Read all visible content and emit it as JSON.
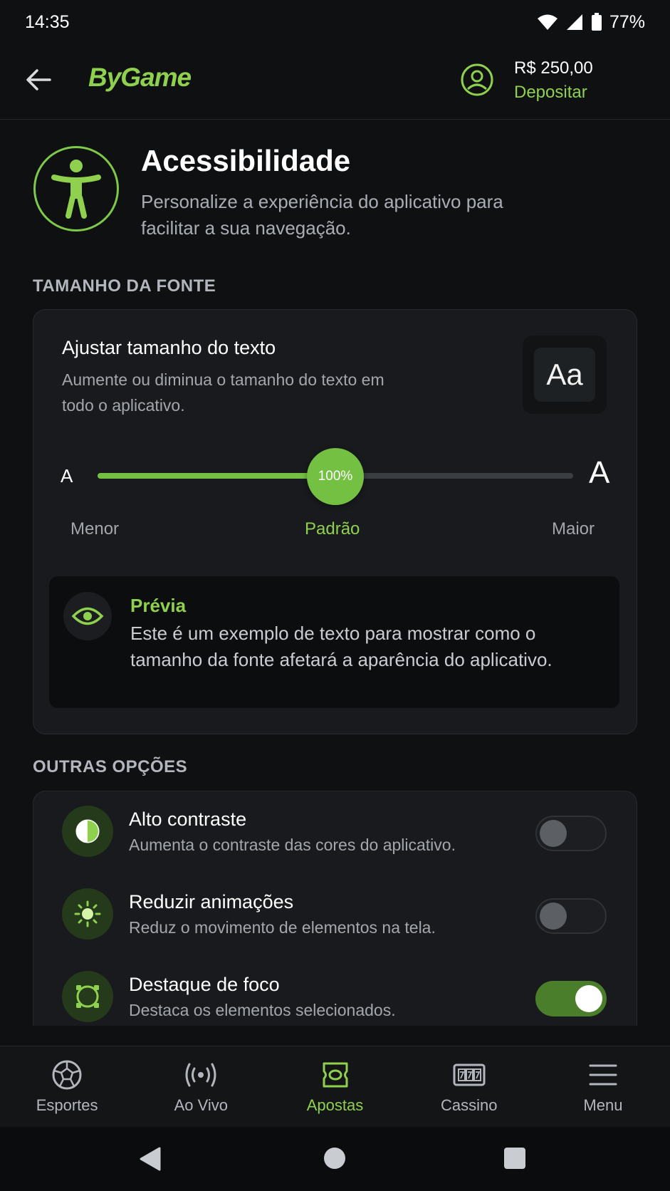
{
  "status_bar": {
    "time": "14:35",
    "battery": "77%"
  },
  "header": {
    "logo": "ByGame",
    "balance": "R$ 250,00",
    "deposit_label": "Depositar"
  },
  "page": {
    "title": "Acessibilidade",
    "subtitle": "Personalize a experiência do aplicativo para facilitar a sua navegação."
  },
  "font_section": {
    "label": "TAMANHO DA FONTE",
    "title": "Ajustar tamanho do texto",
    "description": "Aumente ou diminua o tamanho do texto em todo o aplicativo.",
    "preview_glyph": "Aa",
    "slider": {
      "small_letter": "A",
      "big_letter": "A",
      "value_label": "100%",
      "position_fraction": 0.5,
      "label_min": "Menor",
      "label_default": "Padrão",
      "label_max": "Maior"
    },
    "preview": {
      "title": "Prévia",
      "text": "Este é um exemplo de texto para mostrar como o tamanho da fonte afetará a aparência do aplicativo."
    }
  },
  "options_section": {
    "label": "OUTRAS OPÇÕES",
    "items": [
      {
        "icon": "contrast-icon",
        "title": "Alto contraste",
        "description": "Aumenta o contraste das cores do aplicativo.",
        "enabled": false
      },
      {
        "icon": "sun-icon",
        "title": "Reduzir animações",
        "description": "Reduz o movimento de elementos na tela.",
        "enabled": false
      },
      {
        "icon": "focus-icon",
        "title": "Destaque de foco",
        "description": "Destaca os elementos selecionados.",
        "enabled": true
      }
    ]
  },
  "bottom_nav": {
    "items": [
      {
        "icon": "soccer-ball-icon",
        "label": "Esportes",
        "active": false
      },
      {
        "icon": "live-broadcast-icon",
        "label": "Ao Vivo",
        "active": false
      },
      {
        "icon": "ticket-icon",
        "label": "Apostas",
        "active": true
      },
      {
        "icon": "slot-machine-icon",
        "label": "Cassino",
        "active": false
      },
      {
        "icon": "hamburger-menu-icon",
        "label": "Menu",
        "active": false
      }
    ]
  },
  "colors": {
    "accent": "#8fd14f",
    "background": "#0e1012",
    "card": "#181a1d",
    "toggle_on": "#4a7e2b"
  }
}
